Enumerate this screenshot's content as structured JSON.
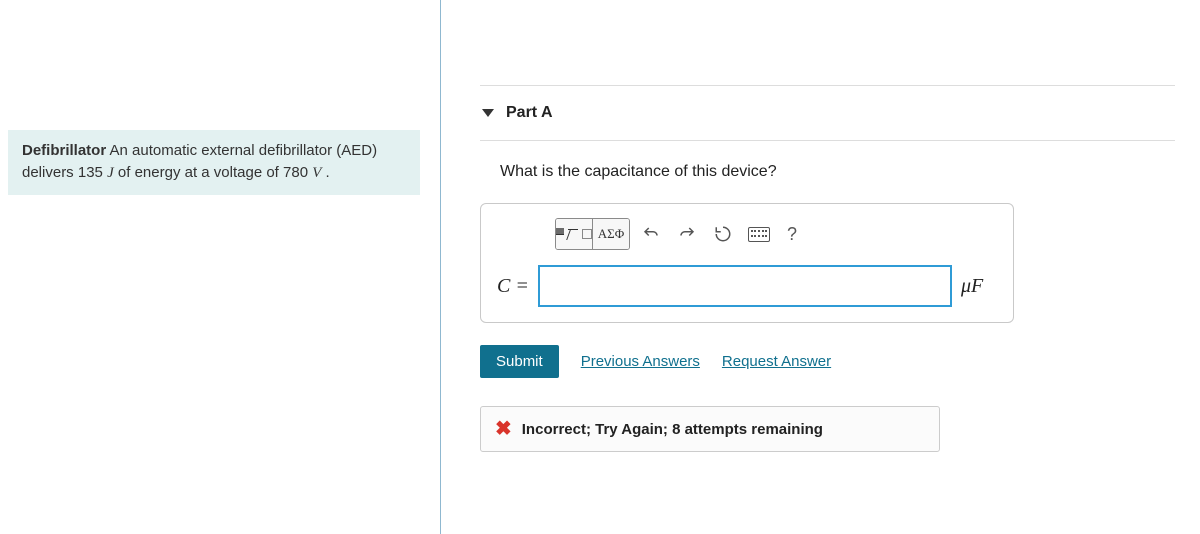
{
  "problem": {
    "title": "Defibrillator",
    "body_before": " An automatic external defibrillator (AED) delivers 135 ",
    "energy_unit": "J",
    "body_mid": " of energy at a voltage of 780 ",
    "voltage_unit": "V",
    "body_after": " ."
  },
  "part": {
    "label": "Part A"
  },
  "question": "What is the capacitance of this device?",
  "toolbar": {
    "greek_label": "ΑΣΦ",
    "help_label": "?"
  },
  "answer": {
    "lhs": "C =",
    "value": "",
    "unit": "μF"
  },
  "buttons": {
    "submit": "Submit",
    "previous": "Previous Answers",
    "request": "Request Answer"
  },
  "feedback": {
    "text": "Incorrect; Try Again; 8 attempts remaining"
  }
}
